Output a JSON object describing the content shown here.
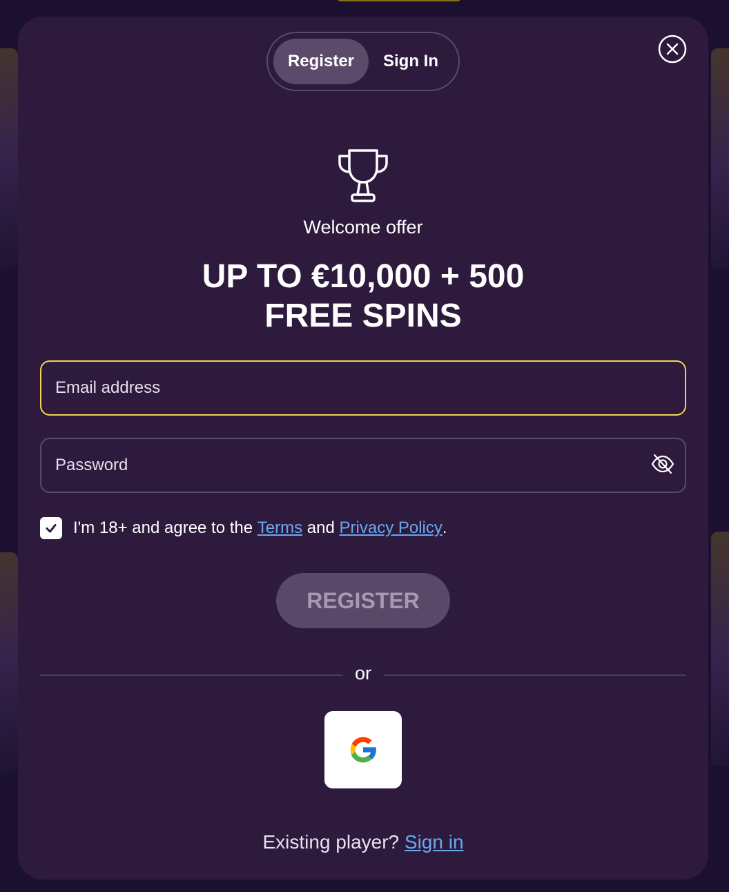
{
  "tabs": {
    "register": "Register",
    "sign_in": "Sign In"
  },
  "offer": {
    "label": "Welcome offer",
    "headline_line1": "UP TO €10,000 + 500",
    "headline_line2": "FREE SPINS"
  },
  "form": {
    "email_placeholder": "Email address",
    "password_placeholder": "Password",
    "terms_prefix": "I'm 18+ and agree to the",
    "terms_link": "Terms",
    "terms_and": "and",
    "privacy_link": "Privacy Policy",
    "terms_suffix": ".",
    "checkbox_checked": true,
    "register_button": "REGISTER"
  },
  "divider": {
    "text": "or"
  },
  "footer": {
    "existing_text": "Existing player?",
    "sign_in_link": "Sign in"
  },
  "icons": {
    "close": "close-icon",
    "trophy": "trophy-icon",
    "password_toggle": "eye-slash-icon",
    "checkbox": "checkmark-icon",
    "google": "google-logo-icon"
  },
  "colors": {
    "modal_background": "#2d1a3d",
    "active_tab": "#5c4a6a",
    "focus_border": "#f2d64b",
    "link": "#6aa8f0",
    "register_button": "#5a4868",
    "register_text": "#a898b6"
  }
}
